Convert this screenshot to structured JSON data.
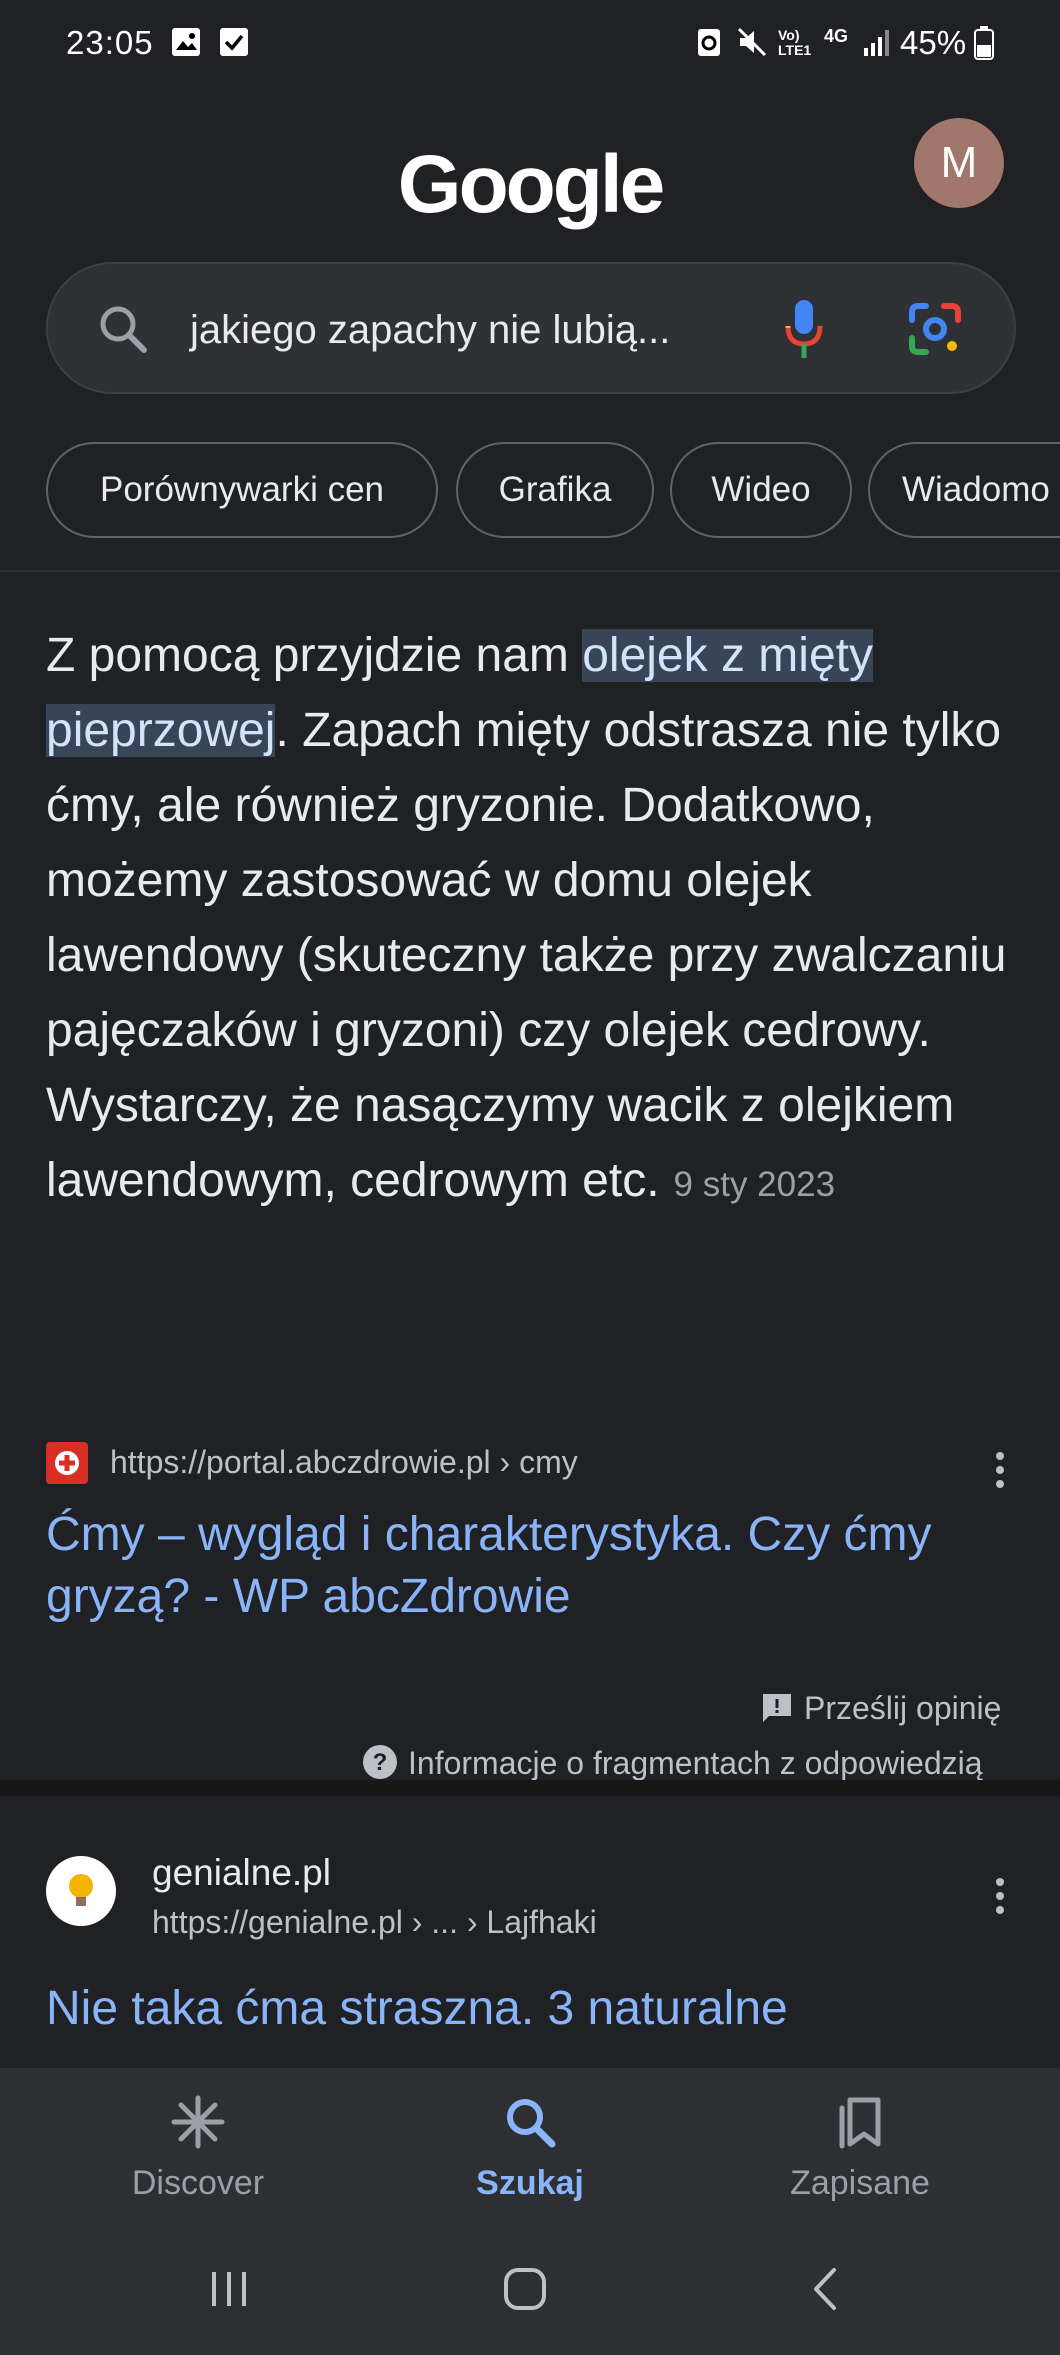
{
  "status_bar": {
    "time": "23:05",
    "network": "Vo) LTE1",
    "net_type": "4G",
    "battery": "45%",
    "icons": [
      "image-icon",
      "check-square-icon",
      "recycle-icon",
      "mute-icon",
      "signal-icon",
      "battery-icon"
    ]
  },
  "header": {
    "logo": "Google",
    "avatar_letter": "M"
  },
  "search": {
    "query": "jakiego zapachy nie lubią..."
  },
  "chips": [
    "Porównywarki cen",
    "Grafika",
    "Wideo",
    "Wiadomo"
  ],
  "snippet": {
    "before": "Z pomocą przyjdzie nam ",
    "highlight": "olejek z mięty pieprzowej",
    "after": ". Zapach mięty odstrasza nie tylko ćmy, ale również gryzonie. Dodatkowo, możemy zastosować w domu olejek lawendowy (skuteczny także przy zwalczaniu pajęczaków i gryzoni) czy olejek cedrowy. Wystarczy, że nasączymy wacik z olejkiem lawendowym, cedrowym etc.",
    "date": "9 sty 2023"
  },
  "result1": {
    "url": "https://portal.abczdrowie.pl › cmy",
    "title": "Ćmy – wygląd i charakterystyka. Czy ćmy gryzą? - WP abcZdrowie",
    "feedback": "Prześlij opinię",
    "about": "Informacje o fragmentach z odpowiedzią"
  },
  "result2": {
    "site": "genialne.pl",
    "url": "https://genialne.pl › ... › Lajfhaki",
    "title": "Nie taka ćma straszna. 3 naturalne"
  },
  "bottom_nav": {
    "discover": "Discover",
    "search": "Szukaj",
    "saved": "Zapisane"
  },
  "colors": {
    "background": "#202124",
    "link": "#8ab4f8",
    "highlight_bg": "#394457"
  }
}
